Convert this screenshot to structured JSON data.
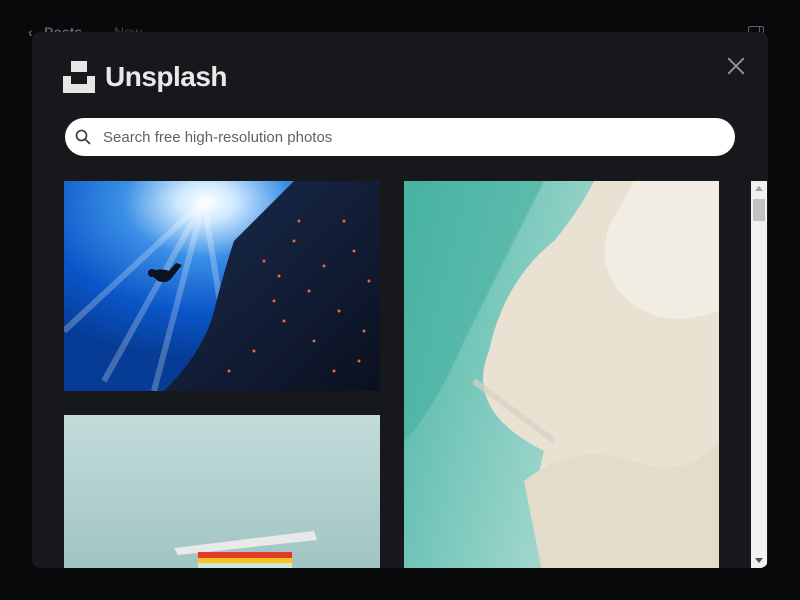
{
  "background": {
    "back_glyph": "‹",
    "posts_label": "Posts",
    "new_label": "New",
    "panel_icon": "sidebar-toggle-icon"
  },
  "modal": {
    "brand": "Unsplash",
    "close_icon": "close-icon",
    "search": {
      "placeholder": "Search free high-resolution photos",
      "value": "",
      "icon": "search-icon"
    },
    "photos": [
      {
        "subject": "diver-and-fish-school",
        "column": 1
      },
      {
        "subject": "lifeguard-tower",
        "column": 1
      },
      {
        "subject": "aerial-beach-sandbar",
        "column": 2
      }
    ]
  },
  "colors": {
    "page_bg": "#08090b",
    "modal_bg": "#17181b",
    "search_bg": "#ffffff",
    "text_light": "#e8e8e8"
  }
}
